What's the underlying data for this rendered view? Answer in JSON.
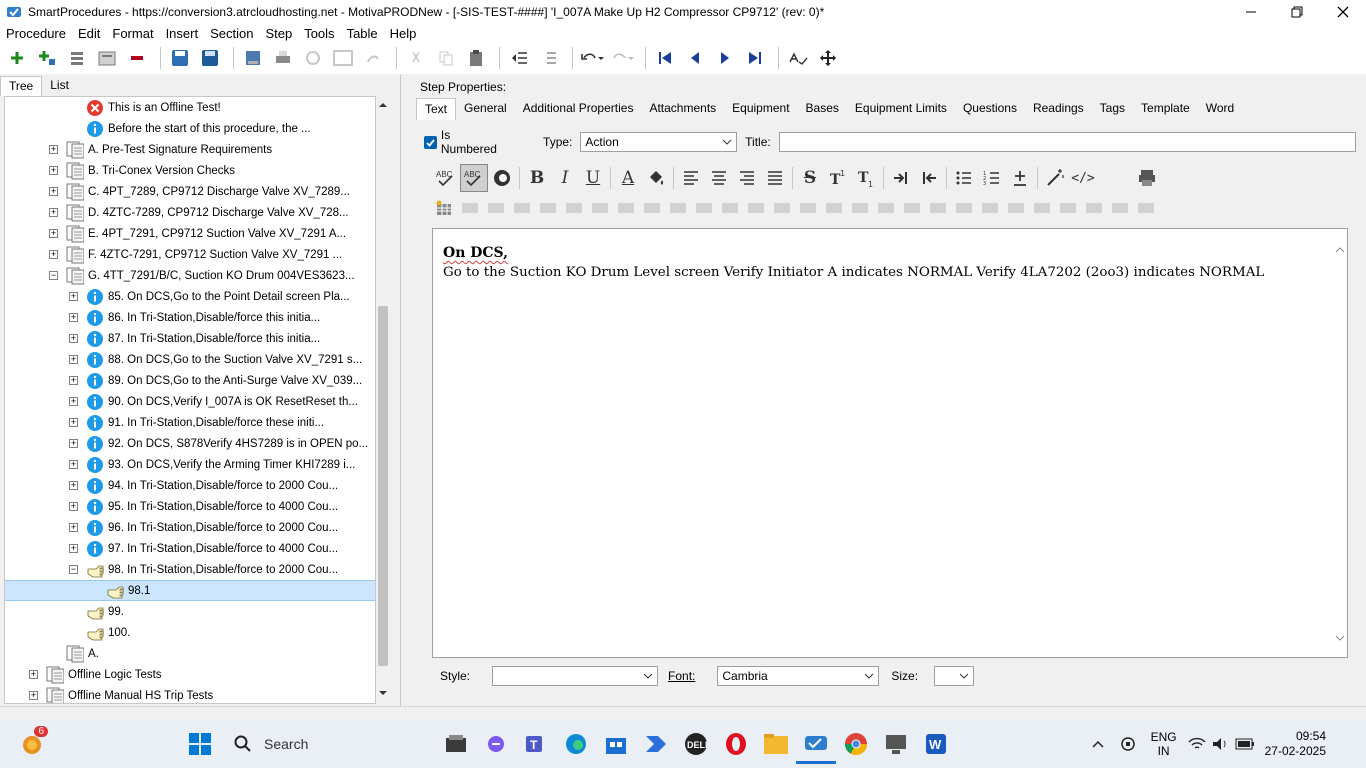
{
  "window": {
    "title": "SmartProcedures - https://conversion3.atrcloudhosting.net - MotivaPRODNew - [-SIS-TEST-####] 'I_007A Make Up H2 Compressor CP9712' (rev: 0)*"
  },
  "menu": [
    "Procedure",
    "Edit",
    "Format",
    "Insert",
    "Section",
    "Step",
    "Tools",
    "Table",
    "Help"
  ],
  "left": {
    "tabs": [
      "Tree",
      "List"
    ],
    "tree": [
      {
        "label": "This is an Offline Test!",
        "icon": "error-icon",
        "exp": "",
        "indent": 2
      },
      {
        "label": "Before the start of this procedure, the ...",
        "icon": "info-icon",
        "exp": "",
        "indent": 2
      },
      {
        "label": "A. Pre-Test Signature Requirements",
        "icon": "section-icon",
        "exp": "+",
        "indent": 1
      },
      {
        "label": "B. Tri-Conex Version Checks",
        "icon": "section-icon",
        "exp": "+",
        "indent": 1
      },
      {
        "label": "C. 4PT_7289, CP9712 Discharge Valve XV_7289...",
        "icon": "section-icon",
        "exp": "+",
        "indent": 1
      },
      {
        "label": "D. 4ZTC-7289, CP9712 Discharge Valve XV_728...",
        "icon": "section-icon",
        "exp": "+",
        "indent": 1
      },
      {
        "label": "E. 4PT_7291, CP9712 Suction Valve XV_7291 A...",
        "icon": "section-icon",
        "exp": "+",
        "indent": 1
      },
      {
        "label": "F. 4ZTC-7291, CP9712 Suction Valve XV_7291 ...",
        "icon": "section-icon",
        "exp": "+",
        "indent": 1
      },
      {
        "label": "G. 4TT_7291/B/C, Suction KO Drum 004VES3623...",
        "icon": "section-icon",
        "exp": "-",
        "indent": 1
      },
      {
        "label": "85. On DCS,Go to the Point Detail screen Pla...",
        "icon": "info-icon",
        "exp": "+",
        "indent": 2
      },
      {
        "label": "86. In Tri-Station,Disable/force this initia...",
        "icon": "info-icon",
        "exp": "+",
        "indent": 2
      },
      {
        "label": "87. In Tri-Station,Disable/force this initia...",
        "icon": "info-icon",
        "exp": "+",
        "indent": 2
      },
      {
        "label": "88. On DCS,Go to the Suction Valve XV_7291 s...",
        "icon": "info-icon",
        "exp": "+",
        "indent": 2
      },
      {
        "label": "89. On DCS,Go to the Anti-Surge Valve XV_039...",
        "icon": "info-icon",
        "exp": "+",
        "indent": 2
      },
      {
        "label": "90. On DCS,Verify I_007A is OK ResetReset th...",
        "icon": "info-icon",
        "exp": "+",
        "indent": 2
      },
      {
        "label": "91. In Tri-Station,Disable/force these initi...",
        "icon": "info-icon",
        "exp": "+",
        "indent": 2
      },
      {
        "label": "92. On DCS, S878Verify 4HS7289 is in OPEN po...",
        "icon": "info-icon",
        "exp": "+",
        "indent": 2
      },
      {
        "label": "93. On DCS,Verify the Arming Timer KHI7289 i...",
        "icon": "info-icon",
        "exp": "+",
        "indent": 2
      },
      {
        "label": "94. In Tri-Station,Disable/force to 2000 Cou...",
        "icon": "info-icon",
        "exp": "+",
        "indent": 2
      },
      {
        "label": "95. In Tri-Station,Disable/force to 4000 Cou...",
        "icon": "info-icon",
        "exp": "+",
        "indent": 2
      },
      {
        "label": "96. In Tri-Station,Disable/force to 2000 Cou...",
        "icon": "info-icon",
        "exp": "+",
        "indent": 2
      },
      {
        "label": "97. In Tri-Station,Disable/force to 4000 Cou...",
        "icon": "info-icon",
        "exp": "+",
        "indent": 2
      },
      {
        "label": "98. In Tri-Station,Disable/force to 2000 Cou...",
        "icon": "action-hand-icon",
        "exp": "-",
        "indent": 2
      },
      {
        "label": "98.1",
        "icon": "action-hand-icon",
        "exp": "",
        "indent": 3,
        "selected": true
      },
      {
        "label": "99.",
        "icon": "action-hand-icon",
        "exp": "",
        "indent": 2
      },
      {
        "label": "100.",
        "icon": "action-hand-icon",
        "exp": "",
        "indent": 2
      },
      {
        "label": "A.",
        "icon": "section-icon",
        "exp": "",
        "indent": 1
      },
      {
        "label": "Offline Logic Tests",
        "icon": "section-icon",
        "exp": "+",
        "indent": 0
      },
      {
        "label": "Offline Manual HS Trip Tests",
        "icon": "section-icon",
        "exp": "+",
        "indent": 0
      }
    ]
  },
  "right": {
    "header": "Step Properties:",
    "tabs": [
      "Text",
      "General",
      "Additional Properties",
      "Attachments",
      "Equipment",
      "Bases",
      "Equipment Limits",
      "Questions",
      "Readings",
      "Tags",
      "Template",
      "Word"
    ],
    "is_numbered_label": "Is Numbered",
    "type_label": "Type:",
    "type_value": "Action",
    "title_label": "Title:",
    "title_value": "",
    "editor_line1": "On DCS,",
    "editor_line2": "Go to the Suction KO Drum Level screen Verify Initiator A indicates NORMAL Verify 4LA7202 (2oo3) indicates NORMAL",
    "style_label": "Style:",
    "style_value": "",
    "font_label": "Font:",
    "font_value": "Cambria",
    "size_label": "Size:",
    "size_value": ""
  },
  "taskbar": {
    "search_placeholder": "Search",
    "notification_count": "6",
    "lang1": "ENG",
    "lang2": "IN",
    "time": "09:54",
    "date": "27-02-2025"
  },
  "colors": {
    "accent": "#0063b1",
    "selection": "#cce6ff",
    "info": "#1e9be8",
    "error": "#e33b2e"
  }
}
